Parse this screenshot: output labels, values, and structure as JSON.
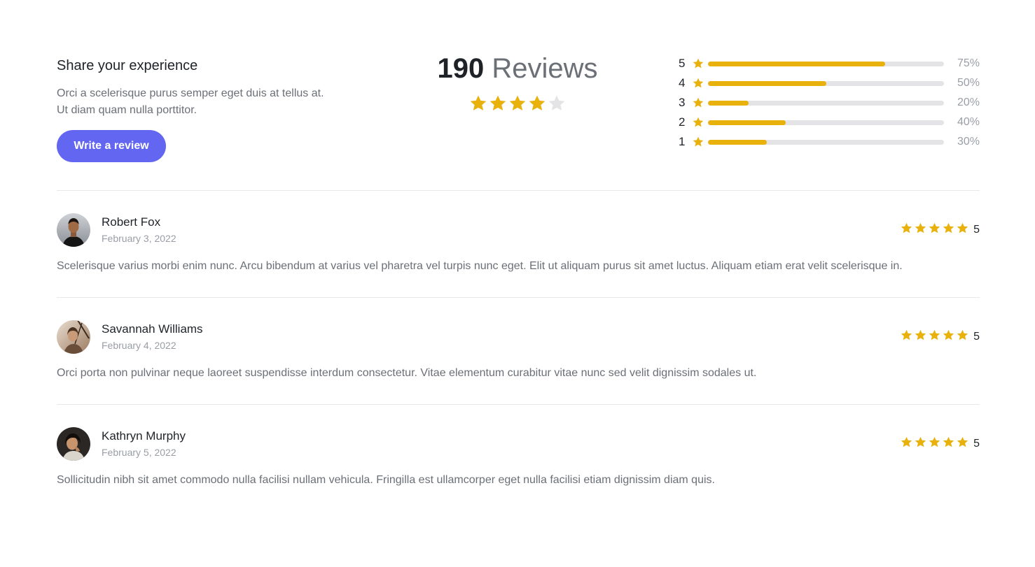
{
  "share": {
    "title": "Share your experience",
    "description_line1": "Orci a scelerisque purus semper eget duis at tellus at.",
    "description_line2": "Ut diam quam nulla porttitor.",
    "button_label": "Write a review"
  },
  "summary": {
    "count": "190",
    "label": "Reviews",
    "average_stars_filled": 4,
    "max_stars": 5
  },
  "distribution": [
    {
      "stars": "5",
      "percent_label": "75%",
      "fraction": 0.75
    },
    {
      "stars": "4",
      "percent_label": "50%",
      "fraction": 0.5
    },
    {
      "stars": "3",
      "percent_label": "20%",
      "fraction": 0.17
    },
    {
      "stars": "2",
      "percent_label": "40%",
      "fraction": 0.33
    },
    {
      "stars": "1",
      "percent_label": "30%",
      "fraction": 0.25
    }
  ],
  "reviews": [
    {
      "name": "Robert Fox",
      "date": "February 3, 2022",
      "rating": "5",
      "text": "Scelerisque varius morbi enim nunc. Arcu bibendum at varius vel pharetra vel turpis nunc eget. Elit ut aliquam purus sit amet luctus. Aliquam etiam erat velit scelerisque in."
    },
    {
      "name": "Savannah Williams",
      "date": "February 4, 2022",
      "rating": "5",
      "text": "Orci porta non pulvinar neque laoreet suspendisse interdum consectetur. Vitae elementum curabitur vitae nunc sed velit dignissim sodales ut."
    },
    {
      "name": "Kathryn Murphy",
      "date": "February 5, 2022",
      "rating": "5",
      "text": "Sollicitudin nibh sit amet commodo nulla facilisi nullam vehicula. Fringilla est ullamcorper eget nulla facilisi etiam dignissim diam quis."
    }
  ],
  "colors": {
    "star_filled": "#e8b10c",
    "star_empty": "#e4e4e7",
    "accent": "#6366f1",
    "bar_track": "#e4e4e7"
  },
  "icons": {
    "star": "star-icon",
    "avatar": "avatar-photo"
  }
}
